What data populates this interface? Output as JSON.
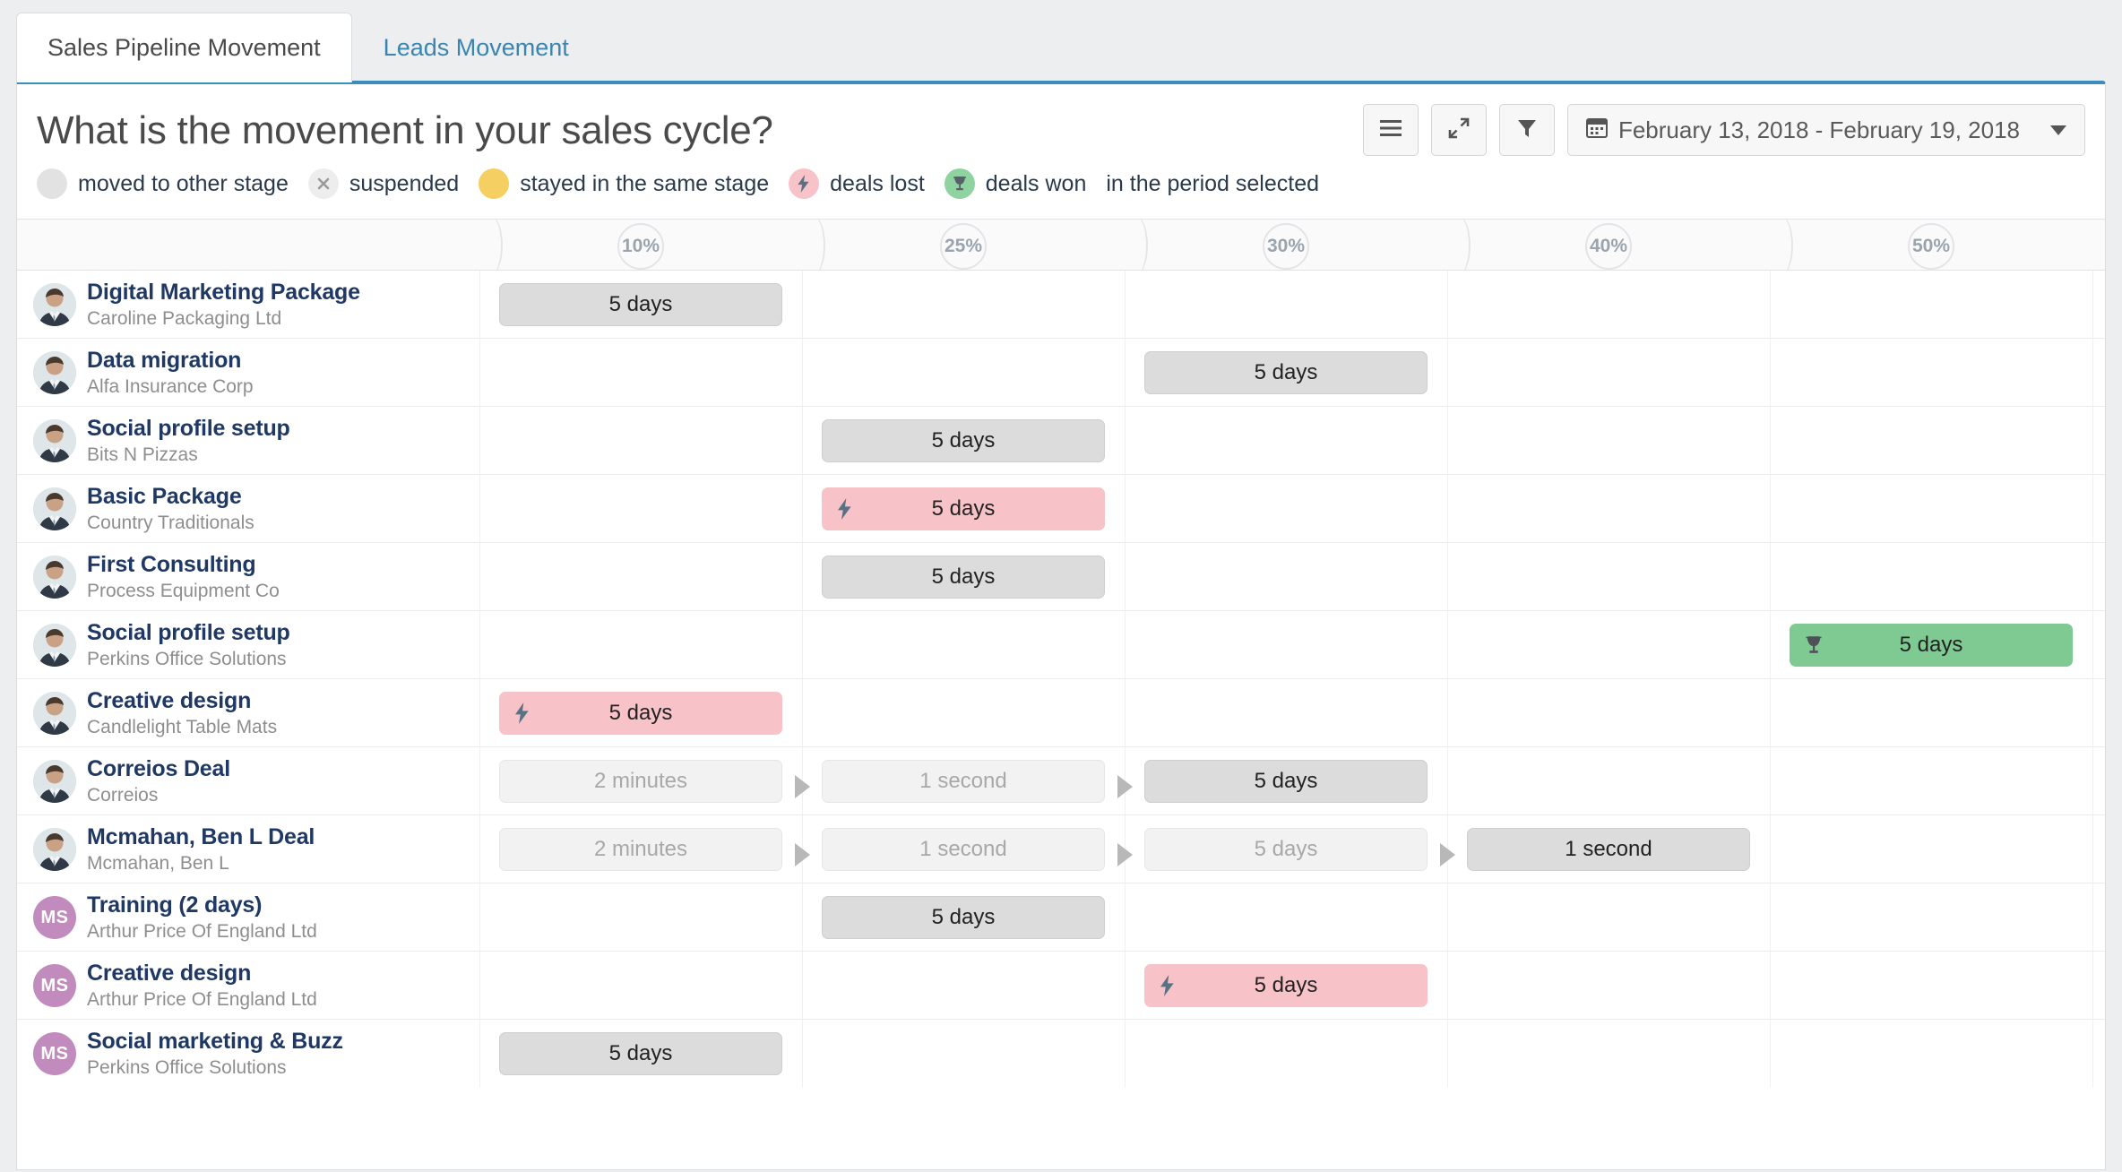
{
  "tabs": [
    {
      "label": "Sales Pipeline Movement",
      "active": true
    },
    {
      "label": "Leads Movement",
      "active": false
    }
  ],
  "header": {
    "title": "What is the movement in your sales cycle?",
    "date_range": "February 13, 2018 - February 19, 2018",
    "buttons": [
      {
        "name": "menu-button",
        "icon": "hamburger-icon"
      },
      {
        "name": "expand-button",
        "icon": "expand-arrows-icon"
      },
      {
        "name": "filter-button",
        "icon": "funnel-icon"
      }
    ]
  },
  "legend": {
    "items": [
      {
        "icon": "gray-circle-icon",
        "label": "moved to other stage",
        "color": "#e2e2e2"
      },
      {
        "icon": "x-circle-icon",
        "label": "suspended",
        "color": "#ededed"
      },
      {
        "icon": "yellow-circle-icon",
        "label": "stayed in the same stage",
        "color": "#f5cf61"
      },
      {
        "icon": "bolt-circle-icon",
        "label": "deals lost",
        "color": "#f7c3c9"
      },
      {
        "icon": "trophy-circle-icon",
        "label": "deals won",
        "color": "#8ed3a0"
      }
    ],
    "suffix": "in the period selected"
  },
  "stages": [
    {
      "pct": "10%"
    },
    {
      "pct": "25%"
    },
    {
      "pct": "30%"
    },
    {
      "pct": "40%"
    },
    {
      "pct": "50%"
    }
  ],
  "rows": [
    {
      "deal": "Digital Marketing Package",
      "org": "Caroline Packaging Ltd",
      "avatar": {
        "type": "photo",
        "initials": ""
      },
      "segments": [
        {
          "col": 0,
          "label": "5 days",
          "state": "moved",
          "icon": ""
        }
      ]
    },
    {
      "deal": "Data migration",
      "org": "Alfa Insurance Corp",
      "avatar": {
        "type": "photo",
        "initials": ""
      },
      "segments": [
        {
          "col": 2,
          "label": "5 days",
          "state": "moved",
          "icon": ""
        }
      ]
    },
    {
      "deal": "Social profile setup",
      "org": "Bits N Pizzas",
      "avatar": {
        "type": "photo",
        "initials": ""
      },
      "segments": [
        {
          "col": 1,
          "label": "5 days",
          "state": "moved",
          "icon": ""
        }
      ]
    },
    {
      "deal": "Basic Package",
      "org": "Country Traditionals",
      "avatar": {
        "type": "photo",
        "initials": ""
      },
      "segments": [
        {
          "col": 1,
          "label": "5 days",
          "state": "lost",
          "icon": "bolt-icon"
        }
      ]
    },
    {
      "deal": "First Consulting",
      "org": "Process Equipment Co",
      "avatar": {
        "type": "photo",
        "initials": ""
      },
      "segments": [
        {
          "col": 1,
          "label": "5 days",
          "state": "moved",
          "icon": ""
        }
      ]
    },
    {
      "deal": "Social profile setup",
      "org": "Perkins Office Solutions",
      "avatar": {
        "type": "photo",
        "initials": ""
      },
      "segments": [
        {
          "col": 4,
          "label": "5 days",
          "state": "won",
          "icon": "trophy-icon"
        }
      ]
    },
    {
      "deal": "Creative design",
      "org": "Candlelight Table Mats",
      "avatar": {
        "type": "photo",
        "initials": ""
      },
      "segments": [
        {
          "col": 0,
          "label": "5 days",
          "state": "lost",
          "icon": "bolt-icon"
        }
      ]
    },
    {
      "deal": "Correios Deal",
      "org": "Correios",
      "avatar": {
        "type": "photo",
        "initials": ""
      },
      "segments": [
        {
          "col": 0,
          "label": "2 minutes",
          "state": "faded",
          "icon": ""
        },
        {
          "col": 1,
          "label": "1 second",
          "state": "faded",
          "icon": ""
        },
        {
          "col": 2,
          "label": "5 days",
          "state": "moved",
          "icon": ""
        }
      ]
    },
    {
      "deal": "Mcmahan, Ben L Deal",
      "org": "Mcmahan, Ben L",
      "avatar": {
        "type": "photo",
        "initials": ""
      },
      "segments": [
        {
          "col": 0,
          "label": "2 minutes",
          "state": "faded",
          "icon": ""
        },
        {
          "col": 1,
          "label": "1 second",
          "state": "faded",
          "icon": ""
        },
        {
          "col": 2,
          "label": "5 days",
          "state": "faded",
          "icon": ""
        },
        {
          "col": 3,
          "label": "1 second",
          "state": "moved",
          "icon": ""
        }
      ]
    },
    {
      "deal": "Training (2 days)",
      "org": "Arthur Price Of England Ltd",
      "avatar": {
        "type": "initials",
        "initials": "MS"
      },
      "segments": [
        {
          "col": 1,
          "label": "5 days",
          "state": "moved",
          "icon": ""
        }
      ]
    },
    {
      "deal": "Creative design",
      "org": "Arthur Price Of England Ltd",
      "avatar": {
        "type": "initials",
        "initials": "MS"
      },
      "segments": [
        {
          "col": 2,
          "label": "5 days",
          "state": "lost",
          "icon": "bolt-icon"
        }
      ]
    },
    {
      "deal": "Social marketing & Buzz",
      "org": "Perkins Office Solutions",
      "avatar": {
        "type": "initials",
        "initials": "MS"
      },
      "segments": [
        {
          "col": 0,
          "label": "5 days",
          "state": "moved",
          "icon": ""
        }
      ]
    }
  ],
  "colors": {
    "tab_active_underline": "#3a8dbd",
    "deal_title": "#1f3864",
    "lost": "#f7c3c9",
    "won": "#7fc992",
    "moved": "#dcdcdc"
  }
}
